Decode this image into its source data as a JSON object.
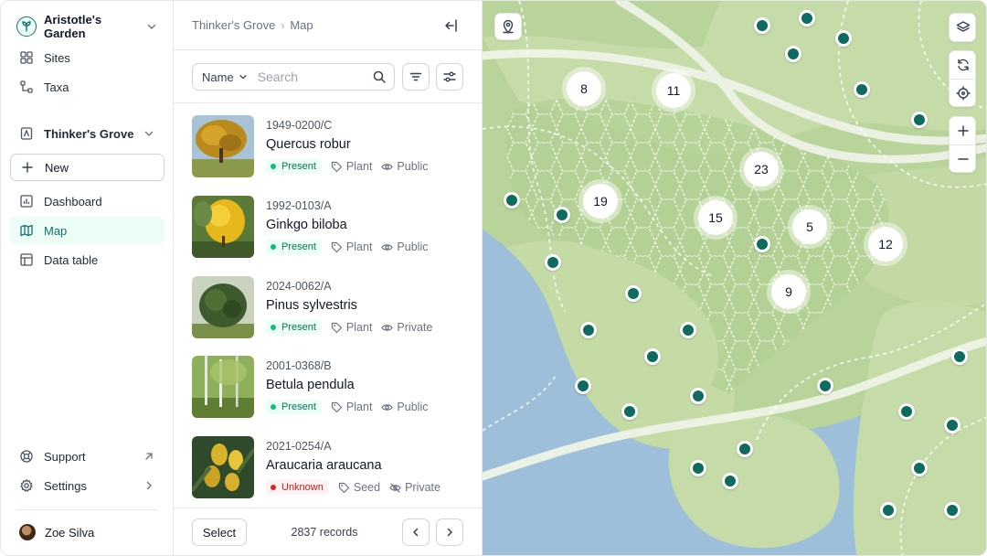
{
  "colors": {
    "accent": "#0f766e",
    "present": "#10b981",
    "unknown": "#dc2626",
    "pin": "#0f6b5e",
    "water": "#9dbfd9"
  },
  "sidebar": {
    "org_name": "Aristotle's Garden",
    "items_top": [
      {
        "label": "Sites",
        "icon": "grid-icon"
      },
      {
        "label": "Taxa",
        "icon": "hierarchy-icon"
      }
    ],
    "group_title": "Thinker's Grove",
    "new_label": "New",
    "items_group": [
      {
        "label": "Dashboard",
        "icon": "bar-chart-icon"
      },
      {
        "label": "Map",
        "icon": "map-icon",
        "active": true
      },
      {
        "label": "Data table",
        "icon": "table-icon"
      }
    ],
    "support_label": "Support",
    "settings_label": "Settings",
    "user_name": "Zoe Silva"
  },
  "panel": {
    "breadcrumb": [
      "Thinker's Grove",
      "Map"
    ],
    "search": {
      "field": "Name",
      "placeholder": "Search"
    },
    "records": [
      {
        "accession": "1949-0200/C",
        "taxon": "Quercus robur",
        "status": "Present",
        "type": "Plant",
        "visibility": "Public"
      },
      {
        "accession": "1992-0103/A",
        "taxon": "Ginkgo biloba",
        "status": "Present",
        "type": "Plant",
        "visibility": "Public"
      },
      {
        "accession": "2024-0062/A",
        "taxon": "Pinus sylvestris",
        "status": "Present",
        "type": "Plant",
        "visibility": "Private"
      },
      {
        "accession": "2001-0368/B",
        "taxon": "Betula pendula",
        "status": "Present",
        "type": "Plant",
        "visibility": "Public"
      },
      {
        "accession": "2021-0254/A",
        "taxon": "Araucaria araucana",
        "status": "Unknown",
        "type": "Seed",
        "visibility": "Private"
      }
    ],
    "select_label": "Select",
    "record_count": "2837 records"
  },
  "map": {
    "clusters": [
      "8",
      "11",
      "23",
      "19",
      "15",
      "5",
      "12",
      "9"
    ]
  }
}
